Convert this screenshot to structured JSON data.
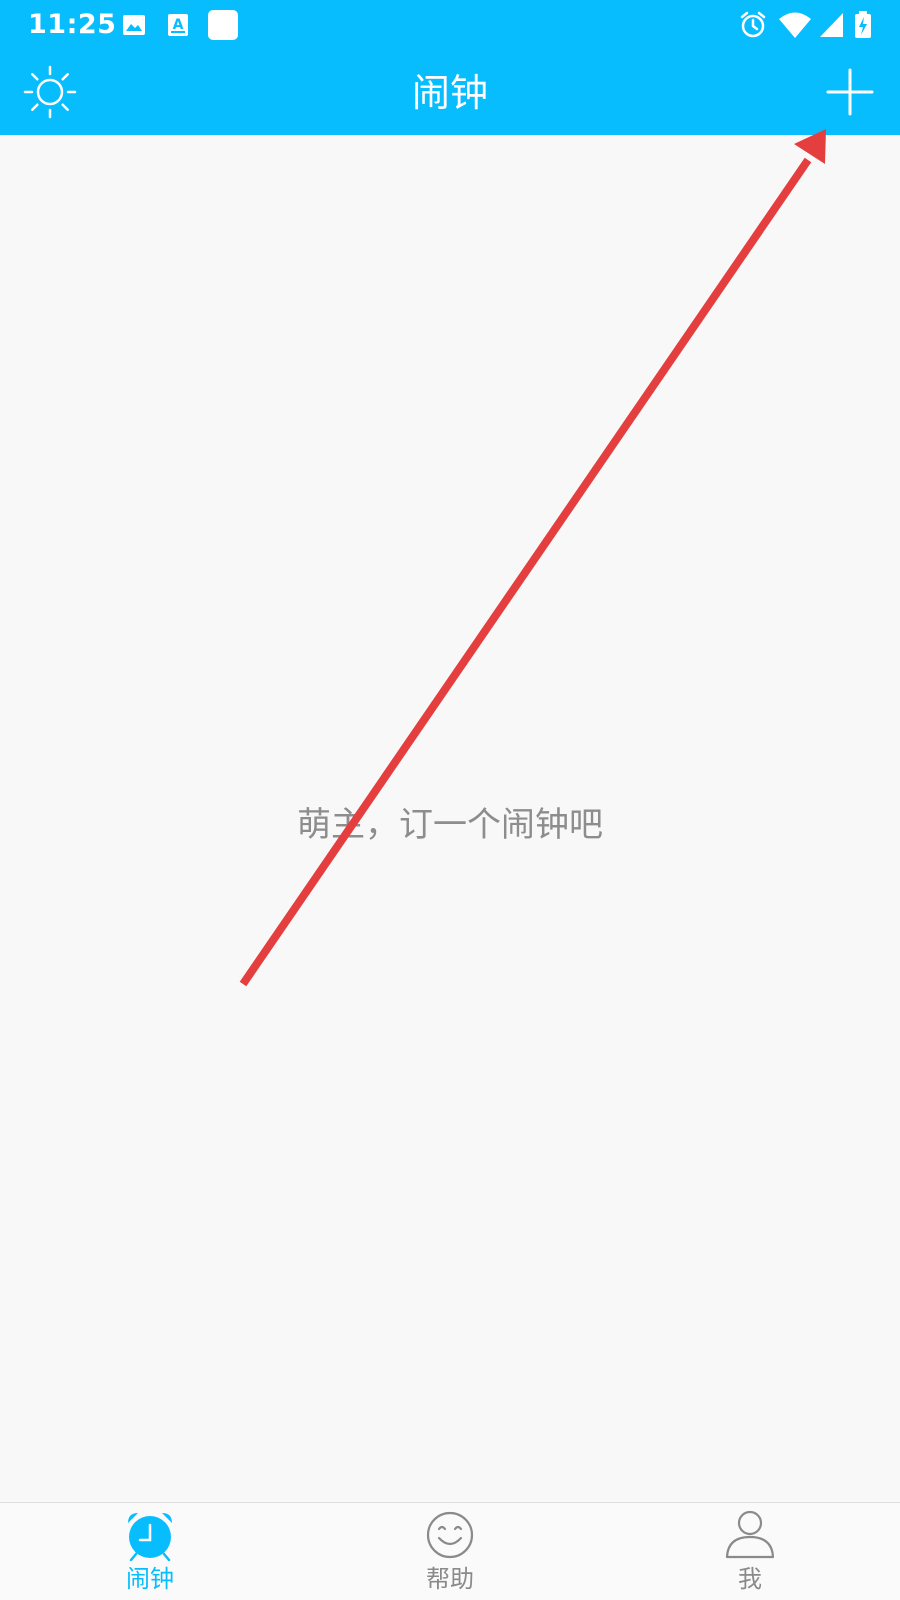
{
  "status_bar": {
    "time": "11:25",
    "left_icons": [
      "image-icon",
      "font-icon",
      "app-square-icon"
    ],
    "right_icons": [
      "alarm-icon",
      "wifi-icon",
      "cell-signal-icon",
      "battery-charging-icon"
    ]
  },
  "header": {
    "title": "闹钟",
    "left_icon": "sun-icon",
    "right_icon": "plus-icon"
  },
  "main": {
    "empty_message": "萌主，订一个闹钟吧"
  },
  "bottom_nav": {
    "items": [
      {
        "label": "闹钟",
        "icon": "alarm-clock-icon",
        "active": true
      },
      {
        "label": "帮助",
        "icon": "smile-icon",
        "active": false
      },
      {
        "label": "我",
        "icon": "person-icon",
        "active": false
      }
    ]
  },
  "colors": {
    "primary": "#07bdfd",
    "background": "#f8f8f9",
    "inactive_text": "#8a8a8a",
    "annotation_arrow": "#e53e3e"
  }
}
